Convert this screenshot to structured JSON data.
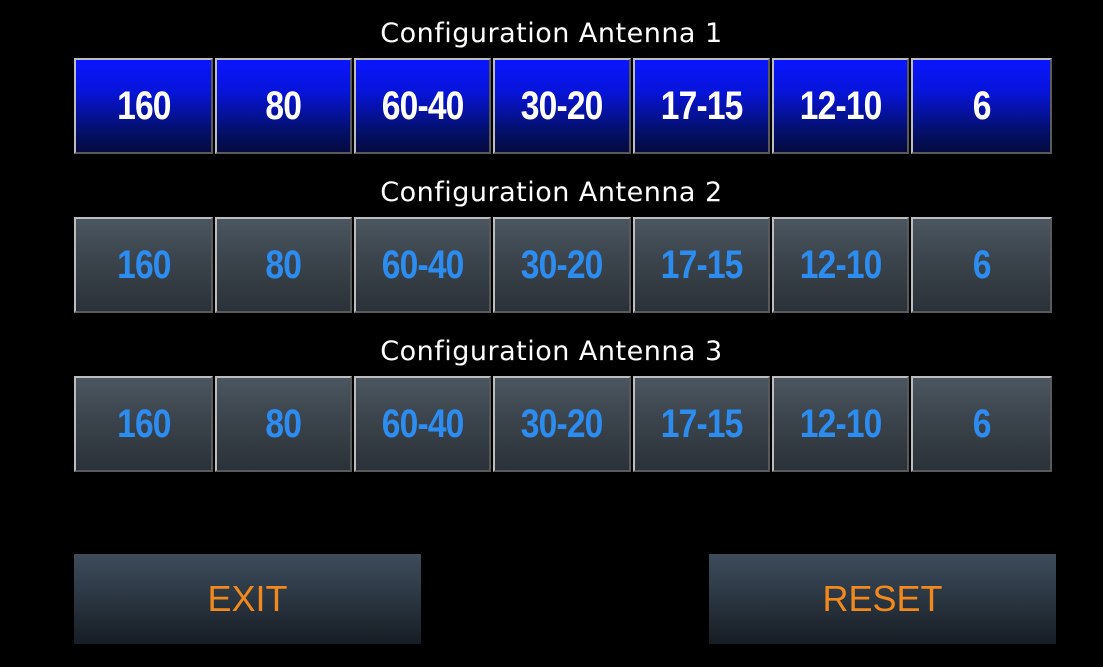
{
  "antennas": [
    {
      "title": "Configuration Antenna 1",
      "bands": [
        "160",
        "80",
        "60-40",
        "30-20",
        "17-15",
        "12-10",
        "6"
      ],
      "active": [
        true,
        true,
        true,
        true,
        true,
        true,
        true
      ]
    },
    {
      "title": "Configuration Antenna 2",
      "bands": [
        "160",
        "80",
        "60-40",
        "30-20",
        "17-15",
        "12-10",
        "6"
      ],
      "active": [
        false,
        false,
        false,
        false,
        false,
        false,
        false
      ]
    },
    {
      "title": "Configuration Antenna 3",
      "bands": [
        "160",
        "80",
        "60-40",
        "30-20",
        "17-15",
        "12-10",
        "6"
      ],
      "active": [
        false,
        false,
        false,
        false,
        false,
        false,
        false
      ]
    }
  ],
  "actions": {
    "exit_label": "EXIT",
    "reset_label": "RESET"
  },
  "colors": {
    "background": "#000000",
    "active_band_bg": "#0714d8",
    "active_band_text": "#ffffff",
    "inactive_band_bg": "#3b444c",
    "inactive_band_text": "#2d8cf0",
    "action_text": "#f2891c"
  }
}
